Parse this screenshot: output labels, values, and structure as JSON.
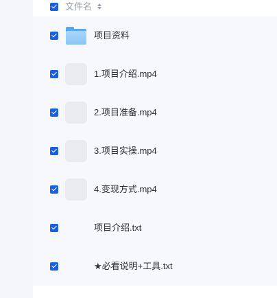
{
  "file_list": {
    "header": {
      "column_label": "文件名",
      "sort_icon": "sort-icon",
      "checked": true
    },
    "items": [
      {
        "name": "项目资料",
        "type": "folder",
        "icon": "folder-icon",
        "checked": true
      },
      {
        "name": "1.项目介绍.mp4",
        "type": "video",
        "icon": "video-thumbnail",
        "checked": true
      },
      {
        "name": "2.项目准备.mp4",
        "type": "video",
        "icon": "video-thumbnail",
        "checked": true
      },
      {
        "name": "3.项目实操.mp4",
        "type": "video",
        "icon": "video-thumbnail",
        "checked": true
      },
      {
        "name": "4.变现方式.mp4",
        "type": "video",
        "icon": "video-thumbnail",
        "checked": true
      },
      {
        "name": "项目介绍.txt",
        "type": "text",
        "icon": "",
        "checked": true
      },
      {
        "name": "★必看说明+工具.txt",
        "type": "text",
        "icon": "",
        "checked": true
      }
    ]
  },
  "colors": {
    "accent": "#1a5fe0",
    "list_background": "#f7f8fe",
    "sidebar_background": "#f5f6fb",
    "folder": "#8cc6f6"
  }
}
